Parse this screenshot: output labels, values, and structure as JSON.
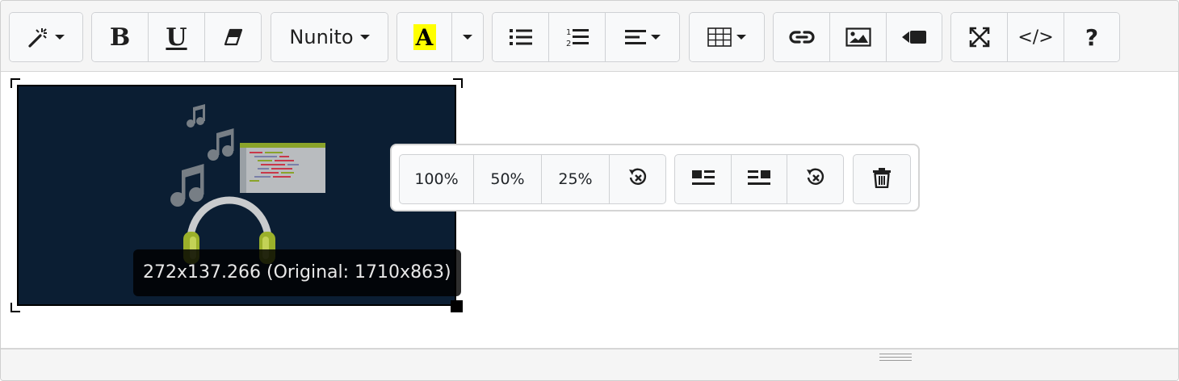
{
  "toolbar": {
    "style_icon": "magic-wand-icon",
    "bold_label": "B",
    "underline_label": "U",
    "clear_format_icon": "eraser-icon",
    "font_name": "Nunito",
    "color_label": "A",
    "highlight_color": "#ffff00",
    "unordered_list_icon": "list-ul-icon",
    "ordered_list_icon": "list-ol-icon",
    "ordered_list_numbers": [
      "1",
      "2"
    ],
    "align_icon": "align-left-icon",
    "table_icon": "table-icon",
    "link_icon": "link-icon",
    "image_icon": "picture-icon",
    "video_icon": "video-icon",
    "fullscreen_icon": "expand-icon",
    "codeview_label": "</>",
    "help_label": "?"
  },
  "image": {
    "description_icon": "music-headphones-image",
    "size_tooltip": "272x137.266 (Original: 1710x863)"
  },
  "image_popover": {
    "resize_full": "100%",
    "resize_half": "50%",
    "resize_quarter": "25%",
    "reset_size_icon": "rotate-left-icon",
    "float_left_icon": "float-left-icon",
    "float_right_icon": "float-right-icon",
    "float_none_icon": "rotate-left-icon",
    "remove_icon": "trash-icon"
  },
  "colors": {
    "toolbar_bg": "#f5f5f5",
    "button_bg": "#f8f9fa",
    "image_bg": "#0b1e33",
    "headphones_accent": "#9bb02a"
  }
}
